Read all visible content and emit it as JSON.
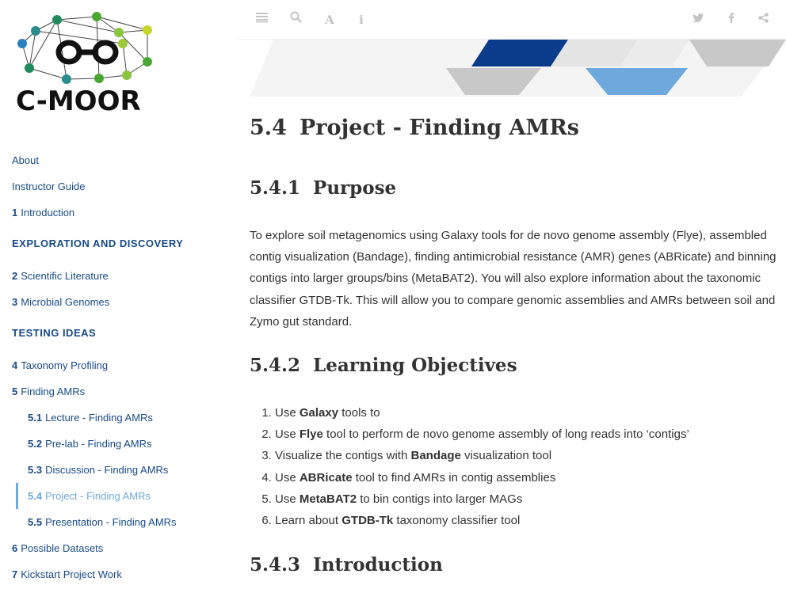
{
  "logo": {
    "text": "C-MOOR"
  },
  "sidebar": {
    "items": [
      {
        "type": "link",
        "num": "",
        "label": "About"
      },
      {
        "type": "link",
        "num": "",
        "label": "Instructor Guide"
      },
      {
        "type": "link",
        "num": "1",
        "label": "Introduction"
      },
      {
        "type": "header",
        "label": "EXPLORATION AND DISCOVERY"
      },
      {
        "type": "link",
        "num": "2",
        "label": "Scientific Literature"
      },
      {
        "type": "link",
        "num": "3",
        "label": "Microbial Genomes"
      },
      {
        "type": "header",
        "label": "TESTING IDEAS"
      },
      {
        "type": "link",
        "num": "4",
        "label": "Taxonomy Profiling"
      },
      {
        "type": "link",
        "num": "5",
        "label": "Finding AMRs"
      },
      {
        "type": "sub",
        "num": "5.1",
        "label": "Lecture - Finding AMRs"
      },
      {
        "type": "sub",
        "num": "5.2",
        "label": "Pre-lab - Finding AMRs"
      },
      {
        "type": "sub",
        "num": "5.3",
        "label": "Discussion - Finding AMRs"
      },
      {
        "type": "sub",
        "num": "5.4",
        "label": "Project - Finding AMRs",
        "active": true
      },
      {
        "type": "sub",
        "num": "5.5",
        "label": "Presentation - Finding AMRs"
      },
      {
        "type": "link",
        "num": "6",
        "label": "Possible Datasets"
      },
      {
        "type": "link",
        "num": "7",
        "label": "Kickstart Project Work"
      }
    ]
  },
  "toolbar": {
    "left_icons": [
      "toc-toggle-icon",
      "search-icon",
      "font-settings-icon",
      "info-icon"
    ],
    "right_icons": [
      "twitter-icon",
      "facebook-icon",
      "share-icon"
    ]
  },
  "colors": {
    "nav_link": "#164a8a",
    "nav_active": "#6ea8dd",
    "banner_dark": "#0b3c8c",
    "banner_light_blue": "#6ea8dd",
    "banner_grey": "#c8c8c8"
  },
  "page": {
    "chapter_num": "5.4",
    "chapter_title": "Project - Finding AMRs",
    "purpose": {
      "num": "5.4.1",
      "title": "Purpose"
    },
    "purpose_text": "To explore soil metagenomics using Galaxy tools for de novo genome assembly (Flye), assembled contig visualization (Bandage), finding antimicrobial resistance (AMR) genes (ABRicate) and binning contigs into larger groups/bins (MetaBAT2). You will also explore information about the taxonomic classifier GTDB-Tk. This will allow you to compare genomic assemblies and AMRs between soil and Zymo gut standard.",
    "objectives": {
      "num": "5.4.2",
      "title": "Learning Objectives"
    },
    "objective_items": [
      {
        "pre": "Use ",
        "bold": "Galaxy",
        "post": " tools to"
      },
      {
        "pre": "Use ",
        "bold": "Flye",
        "post": " tool to perform de novo genome assembly of long reads into ‘contigs’"
      },
      {
        "pre": "Visualize the contigs with ",
        "bold": "Bandage",
        "post": " visualization tool"
      },
      {
        "pre": "Use ",
        "bold": "ABRicate",
        "post": " tool to find AMRs in contig assemblies"
      },
      {
        "pre": "Use ",
        "bold": "MetaBAT2",
        "post": " to bin contigs into larger MAGs"
      },
      {
        "pre": "Learn about ",
        "bold": "GTDB-Tk",
        "post": " taxonomy classifier tool"
      }
    ],
    "introduction": {
      "num": "5.4.3",
      "title": "Introduction"
    }
  }
}
